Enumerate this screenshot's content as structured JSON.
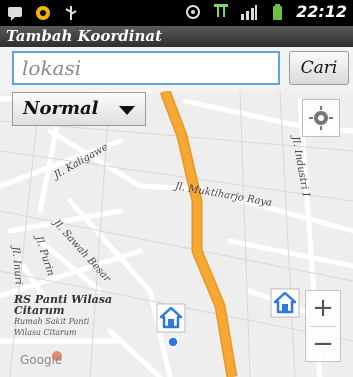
{
  "status_bar": {
    "time": "22:12",
    "icons": [
      "chat-icon",
      "notification-dot-icon",
      "usb-icon",
      "gps-icon",
      "3g-icon",
      "signal-icon",
      "battery-icon"
    ]
  },
  "title_bar": {
    "title": "Tambah Koordinat"
  },
  "search": {
    "placeholder": "lokasi",
    "value": "",
    "button_label": "Cari"
  },
  "map": {
    "map_type": "Normal",
    "zoom_in_label": "+",
    "zoom_out_label": "−",
    "labels": {
      "street_1": "Jl. Industri I",
      "street_2": "Jl. Kaligawe",
      "street_3": "Jl. Muktiharjo Raya",
      "street_4": "Jl. Sawah Besar",
      "street_5": "Jl. Purin",
      "street_6": "Jl. Inuri",
      "poi_name": "RS Panti Wilasa Citarum",
      "poi_sub_1": "Rumah Sakit Panti",
      "poi_sub_2": "Wilasa Citarum",
      "attribution": "Google"
    },
    "icons": [
      "locate-icon",
      "home-marker-icon",
      "location-dot-icon",
      "hospital-icon"
    ],
    "colors": {
      "main_road": "#f6a833",
      "user_dot": "#2f78e0",
      "marker": "#2f78e0"
    }
  }
}
